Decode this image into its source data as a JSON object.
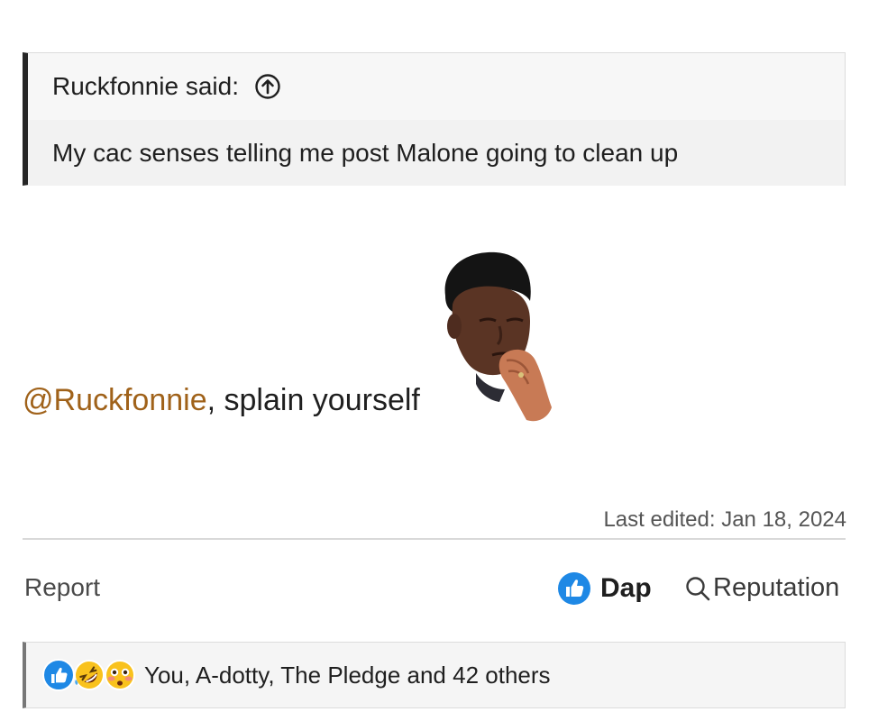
{
  "quote": {
    "author": "Ruckfonnie said:",
    "text": "My cac senses telling me post Malone going to clean up"
  },
  "post": {
    "mention": "@Ruckfonnie",
    "text": ", splain yourself",
    "last_edited": "Last edited: Jan 18, 2024"
  },
  "actions": {
    "report": "Report",
    "dap": "Dap",
    "reputation": "Reputation"
  },
  "reactions": {
    "icons": [
      "like-icon",
      "rofl-icon",
      "flushed-icon"
    ],
    "text": "You, A-dotty, The Pledge and 42 others"
  },
  "colors": {
    "mention": "#a0621a",
    "like_blue": "#1e88e5",
    "quote_border": "#262626"
  }
}
